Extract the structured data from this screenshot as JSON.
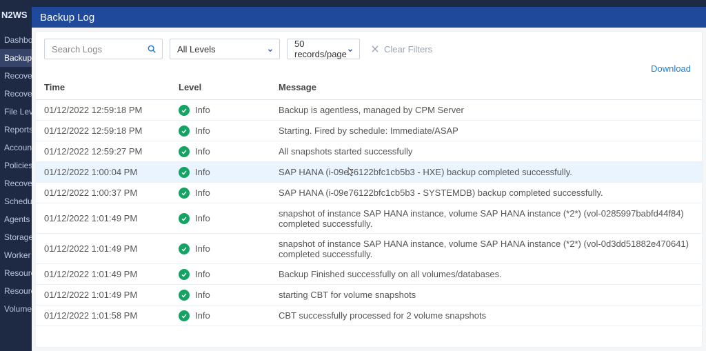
{
  "brand": "N2WS",
  "page_title": "Backup Log",
  "sidebar": {
    "items": [
      {
        "label": "Dashboard"
      },
      {
        "label": "Backup Monitor",
        "active": true
      },
      {
        "label": "Recovery Monitor"
      },
      {
        "label": "Recovery Scenario"
      },
      {
        "label": "File Level Recovery"
      },
      {
        "label": "Reports"
      },
      {
        "label": "Accounts"
      },
      {
        "label": "Policies"
      },
      {
        "label": "Recovery Scenarios"
      },
      {
        "label": "Schedules"
      },
      {
        "label": "Agents"
      },
      {
        "label": "Storage Repository"
      },
      {
        "label": "Worker Configuration"
      },
      {
        "label": "Resource Control"
      },
      {
        "label": "Resource Control"
      },
      {
        "label": "Volume Usage"
      }
    ]
  },
  "filters": {
    "search_placeholder": "Search Logs",
    "level_select": "All Levels",
    "page_size_select": "50 records/page",
    "clear_filters": "Clear Filters"
  },
  "download_label": "Download",
  "table": {
    "headers": {
      "time": "Time",
      "level": "Level",
      "message": "Message"
    },
    "rows": [
      {
        "time": "01/12/2022 12:59:18 PM",
        "level": "Info",
        "message": "Backup is agentless, managed by CPM Server"
      },
      {
        "time": "01/12/2022 12:59:18 PM",
        "level": "Info",
        "message": "Starting. Fired by schedule: Immediate/ASAP"
      },
      {
        "time": "01/12/2022 12:59:27 PM",
        "level": "Info",
        "message": "All snapshots started successfully"
      },
      {
        "time": "01/12/2022 1:00:04 PM",
        "level": "Info",
        "message": "SAP HANA (i-09e76122bfc1cb5b3 - HXE) backup completed successfully.",
        "highlight": true
      },
      {
        "time": "01/12/2022 1:00:37 PM",
        "level": "Info",
        "message": "SAP HANA (i-09e76122bfc1cb5b3 - SYSTEMDB) backup completed successfully."
      },
      {
        "time": "01/12/2022 1:01:49 PM",
        "level": "Info",
        "message": "snapshot of instance SAP HANA instance, volume SAP HANA instance (*2*) (vol-0285997babfd44f84) completed successfully."
      },
      {
        "time": "01/12/2022 1:01:49 PM",
        "level": "Info",
        "message": "snapshot of instance SAP HANA instance, volume SAP HANA instance (*2*) (vol-0d3dd51882e470641) completed successfully."
      },
      {
        "time": "01/12/2022 1:01:49 PM",
        "level": "Info",
        "message": "Backup Finished successfully on all volumes/databases."
      },
      {
        "time": "01/12/2022 1:01:49 PM",
        "level": "Info",
        "message": "starting CBT for volume snapshots"
      },
      {
        "time": "01/12/2022 1:01:58 PM",
        "level": "Info",
        "message": "CBT successfully processed for 2 volume snapshots"
      }
    ]
  },
  "icons": {
    "search": "search-icon",
    "chevron_down": "chevron-down-icon",
    "clear": "x-icon",
    "download": "download-icon",
    "check": "check-icon"
  },
  "colors": {
    "accent": "#1f4a9b",
    "link": "#1f7dd6",
    "success": "#13a463",
    "sidebar": "#1e2a44"
  }
}
